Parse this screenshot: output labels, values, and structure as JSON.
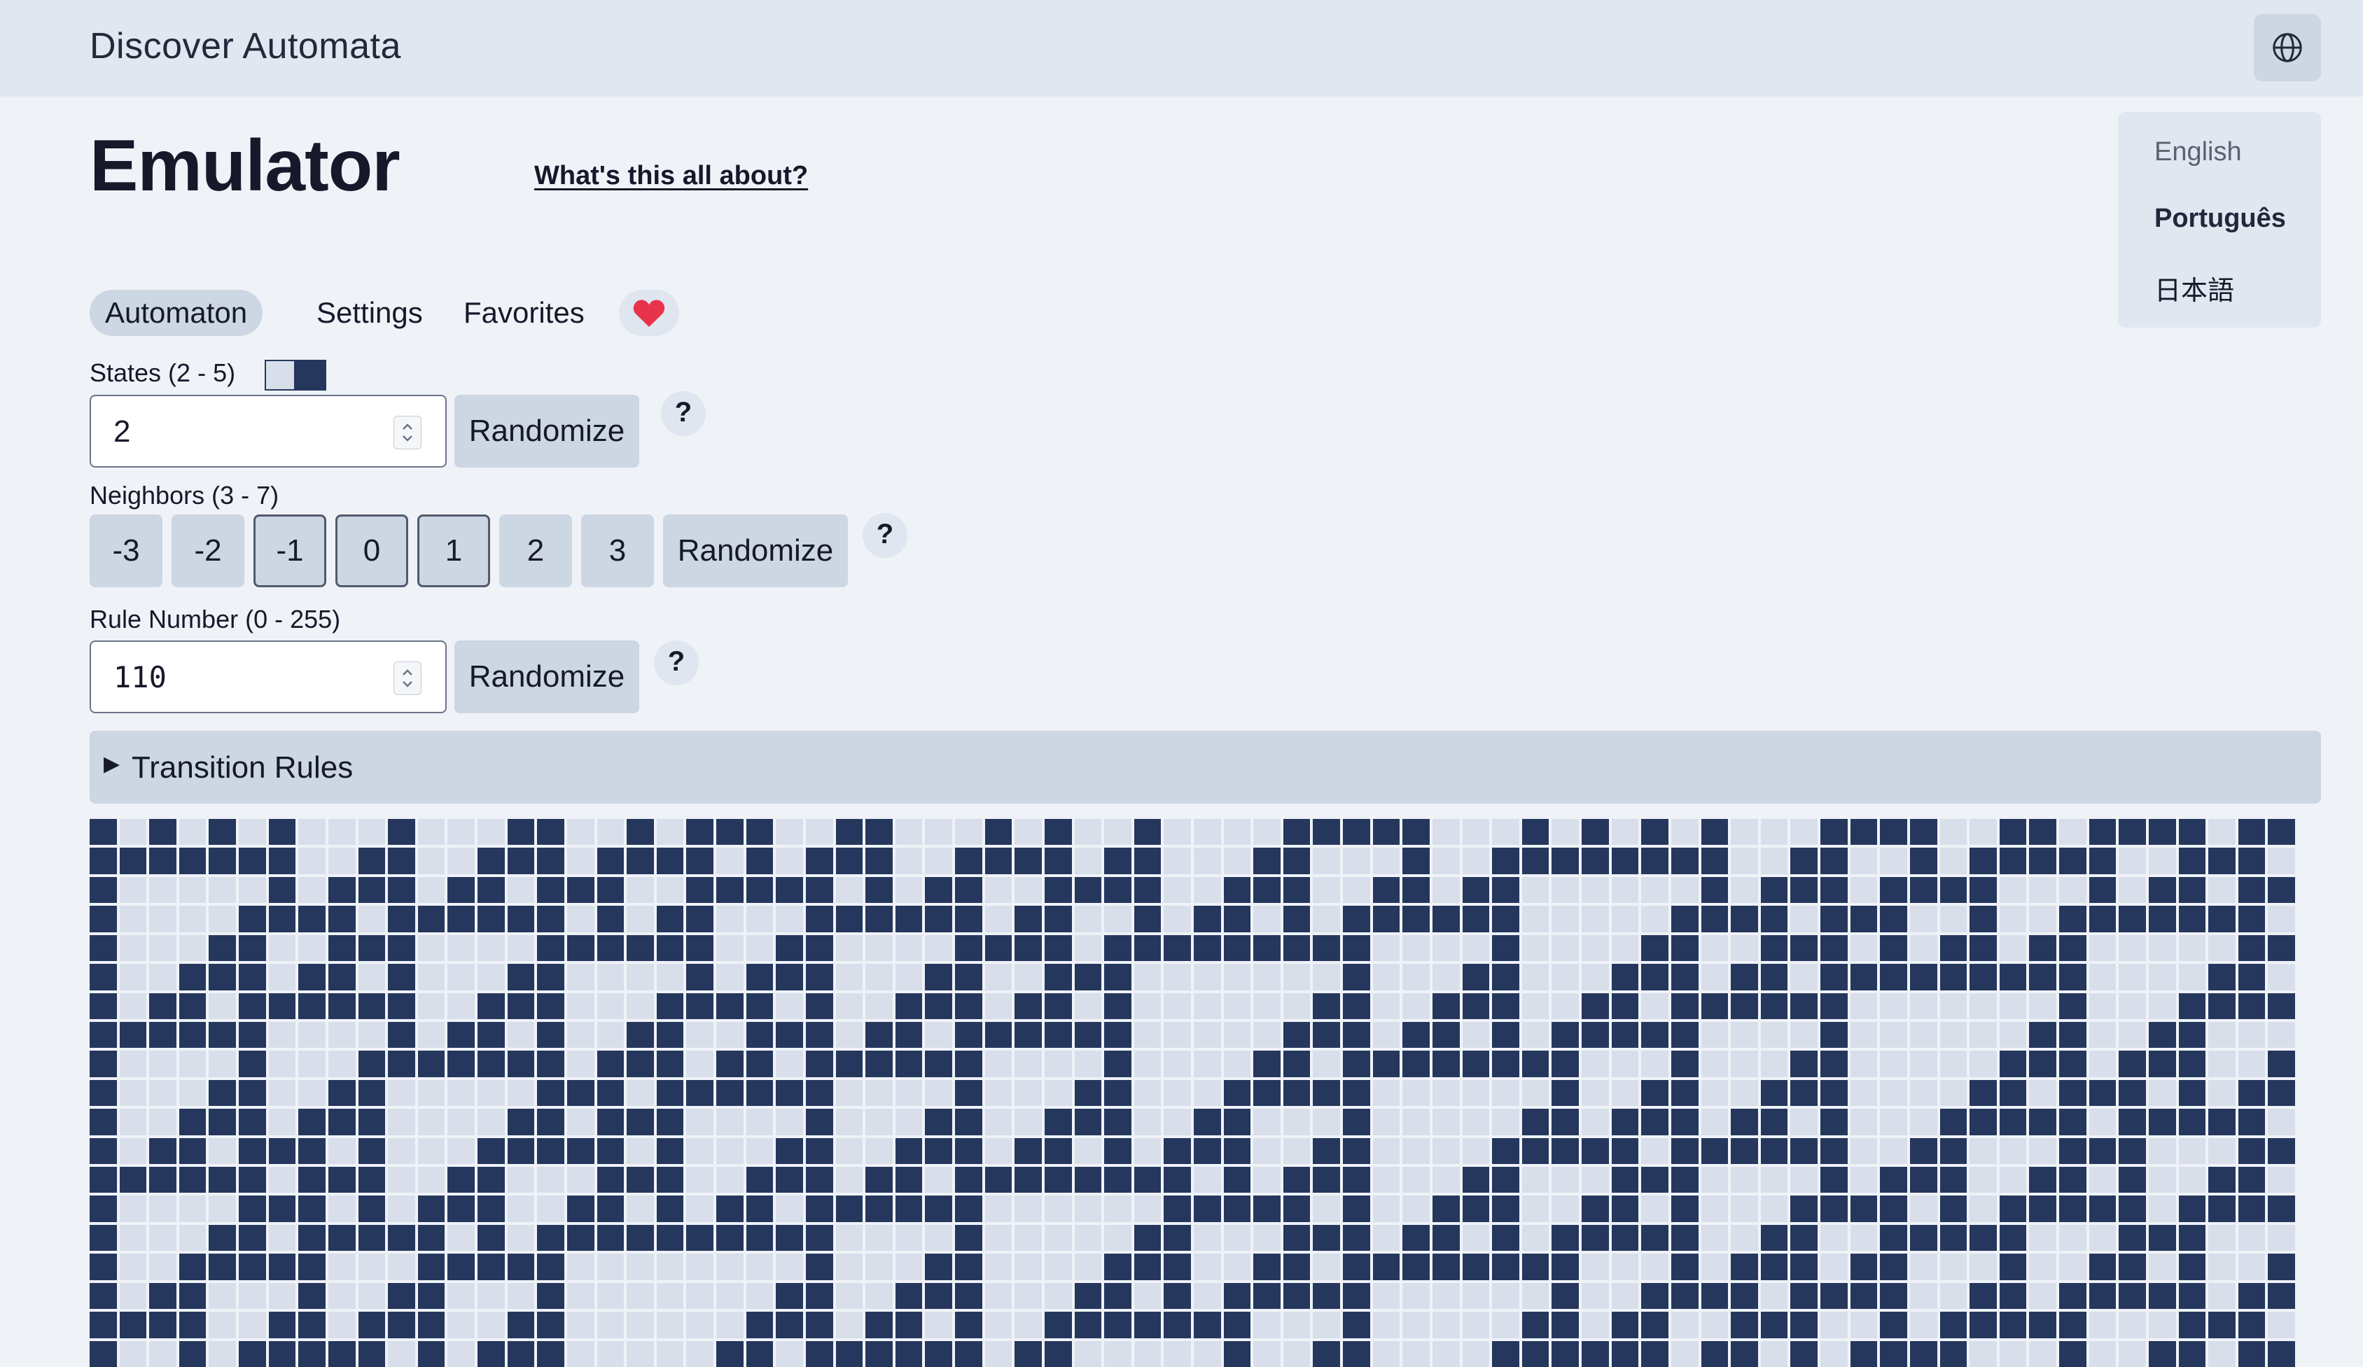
{
  "app": {
    "title": "Discover Automata"
  },
  "header": {
    "language_icon": "globe-icon"
  },
  "page": {
    "title": "Emulator",
    "about_link": "What's this all about?"
  },
  "language_menu": {
    "items": [
      {
        "label": "English"
      },
      {
        "label": "Português"
      },
      {
        "label": "日本語"
      }
    ]
  },
  "tabs": [
    {
      "label": "Automaton",
      "active": true
    },
    {
      "label": "Settings"
    },
    {
      "label": "Favorites"
    }
  ],
  "favorite_icon": "heart-icon",
  "states": {
    "label": "States (2 - 5)",
    "value": "2",
    "randomize": "Randomize",
    "help": "?",
    "colors": [
      "#d9dfea",
      "#26375d"
    ]
  },
  "neighbors": {
    "label": "Neighbors (3 - 7)",
    "offsets": [
      {
        "label": "-3",
        "selected": false
      },
      {
        "label": "-2",
        "selected": false
      },
      {
        "label": "-1",
        "selected": true
      },
      {
        "label": "0",
        "selected": true
      },
      {
        "label": "1",
        "selected": true
      },
      {
        "label": "2",
        "selected": false
      },
      {
        "label": "3",
        "selected": false
      }
    ],
    "randomize": "Randomize",
    "help": "?"
  },
  "rule": {
    "label": "Rule Number (0 - 255)",
    "value": "110",
    "randomize": "Randomize",
    "help": "?"
  },
  "transition_rules": {
    "label": "Transition Rules",
    "expanded": false
  },
  "automaton_grid": {
    "rule": 110,
    "columns": 74,
    "rows": 19,
    "initial_row": "10101010001000110010111001100010100100001111100010101010001111001101111011"
  },
  "colors": {
    "accent": "#26375d",
    "off_cell": "#d9dfea",
    "background": "#eff3f8",
    "topbar": "#e0e7f0",
    "button": "#cdd6e3",
    "heart": "#e8334a"
  }
}
